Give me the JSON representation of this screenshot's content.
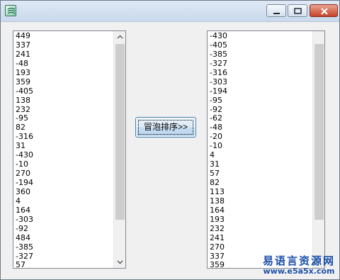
{
  "window": {
    "title": "",
    "controls": [
      "minimize",
      "maximize",
      "close"
    ]
  },
  "left_list": {
    "items": [
      "449",
      "337",
      "241",
      "-48",
      "193",
      "359",
      "-405",
      "138",
      "232",
      "-95",
      "82",
      "-316",
      "31",
      "-430",
      "-10",
      "270",
      "-194",
      "360",
      "4",
      "164",
      "-303",
      "-92",
      "484",
      "-385",
      "-327",
      "57"
    ]
  },
  "right_list": {
    "items": [
      "-430",
      "-405",
      "-385",
      "-327",
      "-316",
      "-303",
      "-194",
      "-95",
      "-92",
      "-62",
      "-48",
      "-20",
      "-10",
      "4",
      "31",
      "57",
      "82",
      "113",
      "138",
      "164",
      "193",
      "232",
      "241",
      "270",
      "337",
      "359"
    ]
  },
  "sort_button": {
    "label": "冒泡排序>>"
  },
  "watermark": {
    "name": "易语言资源网",
    "url": "www.e5a5x.com"
  },
  "colors": {
    "titlebar": "#c9d9ec",
    "close": "#c7422a",
    "button_border": "#3c7fb1",
    "watermark": "#1a4fa8"
  }
}
